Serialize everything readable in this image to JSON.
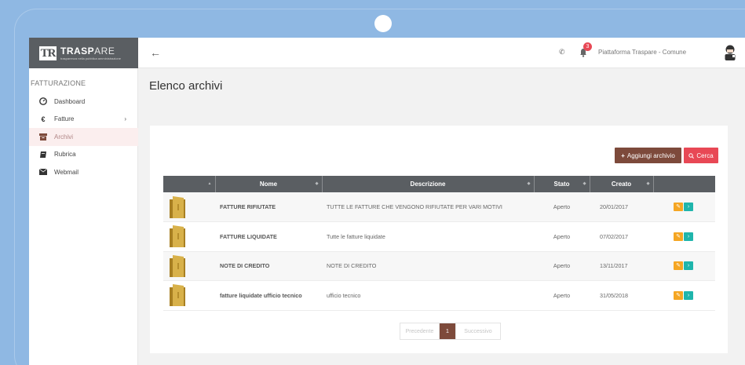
{
  "brand": {
    "logo_mark": "TR",
    "name_main": "TRASP",
    "name_accent": "ARE",
    "tagline": "trasparenza nella pubblica amministrazione"
  },
  "topbar": {
    "back_icon": "arrow-left-icon",
    "notification_count": "3",
    "platform_label": "Piattaforma Traspare - Comune"
  },
  "sidebar": {
    "section_title": "FATTURAZIONE",
    "items": [
      {
        "label": "Dashboard",
        "icon": "dashboard-icon"
      },
      {
        "label": "Fatture",
        "icon": "euro-icon",
        "has_submenu": true
      },
      {
        "label": "Archivi",
        "icon": "archive-icon",
        "active": true
      },
      {
        "label": "Rubrica",
        "icon": "address-book-icon"
      },
      {
        "label": "Webmail",
        "icon": "envelope-icon"
      }
    ]
  },
  "main": {
    "page_title": "Elenco archivi",
    "add_button": "Aggiungi archivio",
    "search_button": "Cerca",
    "table": {
      "headers": [
        "",
        "Nome",
        "Descrizione",
        "Stato",
        "Creato",
        ""
      ],
      "rows": [
        {
          "nome": "FATTURE RIFIUTATE",
          "descrizione": "TUTTE LE FATTURE CHE VENGONO RIFIUTATE PER VARI MOTIVI",
          "stato": "Aperto",
          "creato": "20/01/2017"
        },
        {
          "nome": "FATTURE LIQUIDATE",
          "descrizione": "Tutte le fatture liquidate",
          "stato": "Aperto",
          "creato": "07/02/2017"
        },
        {
          "nome": "NOTE DI CREDITO",
          "descrizione": "NOTE DI CREDITO",
          "stato": "Aperto",
          "creato": "13/11/2017"
        },
        {
          "nome": "fatture liquidate ufficio tecnico",
          "descrizione": "ufficio tecnico",
          "stato": "Aperto",
          "creato": "31/05/2018"
        }
      ]
    },
    "pagination": {
      "prev": "Precedente",
      "current": "1",
      "next": "Successivo"
    }
  },
  "colors": {
    "accent": "#7d4a3b",
    "danger": "#e84855",
    "header_dark": "#5a5e62",
    "frame_blue": "#8fb8e3",
    "edit": "#f5a623",
    "go": "#1fb5ac"
  }
}
